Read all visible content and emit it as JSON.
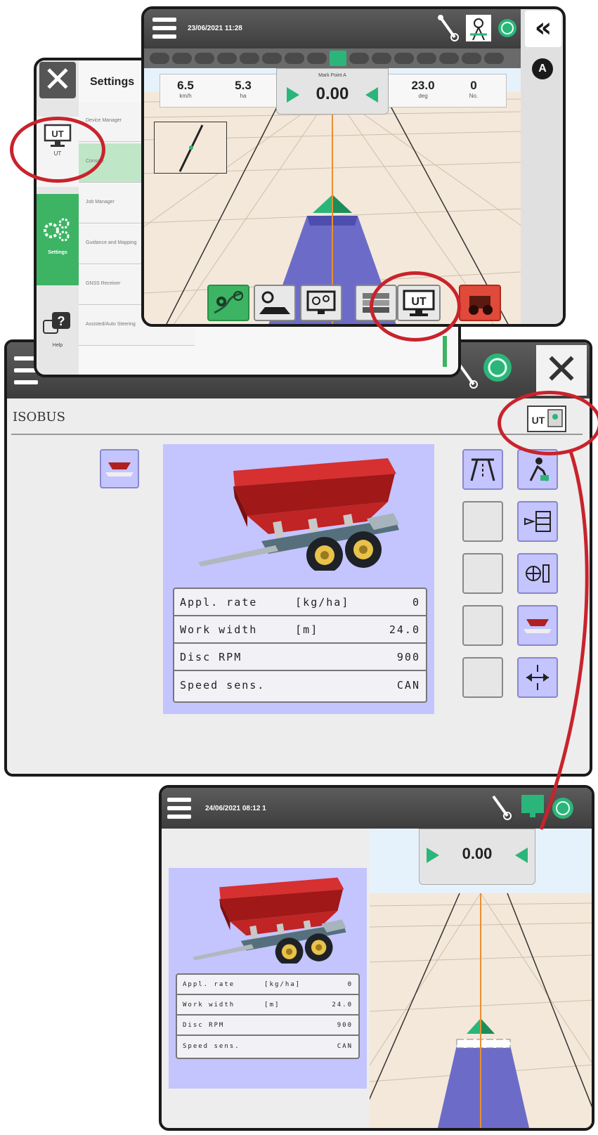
{
  "colors": {
    "accent_green": "#2bb57a",
    "callout_red": "#c8232c",
    "implement_blue": "#c4c4ff",
    "settings_green": "#3cb464"
  },
  "top_screen": {
    "datetime": "23/06/2021 11:28",
    "info_bar": [
      {
        "value": "6.5",
        "unit": "km/h"
      },
      {
        "value": "5.3",
        "unit": "ha"
      },
      {
        "value": "23.0",
        "unit": "deg"
      },
      {
        "value": "0",
        "unit": "No."
      }
    ],
    "guidance": {
      "label": "Mark Point A",
      "value": "0.00"
    },
    "badge": "A",
    "ut_label": "UT",
    "active_progress_segment": 8,
    "progress_segments": 16
  },
  "settings_screen": {
    "title": "Settings",
    "sidebar": [
      {
        "label": "UT"
      },
      {
        "label": "Settings"
      },
      {
        "label": "Help"
      }
    ],
    "items": [
      "Device Manager",
      "Console",
      "Job Manager",
      "Guidance and Mapping",
      "GNSS Receiver",
      "Assisted/Auto Steering"
    ]
  },
  "isobus_screen": {
    "title": "ISOBUS",
    "ut_label": "UT",
    "table": [
      {
        "name": "Appl. rate",
        "unit": "[kg/ha]",
        "value": "0"
      },
      {
        "name": "Work width",
        "unit": "[m]",
        "value": "24.0"
      },
      {
        "name": "Disc RPM",
        "unit": "",
        "value": "900"
      },
      {
        "name": "Speed sens.",
        "unit": "",
        "value": "CAN"
      }
    ]
  },
  "bottom_screen": {
    "datetime": "24/06/2021 08:12 1",
    "guidance_value": "0.00",
    "table": [
      {
        "name": "Appl. rate",
        "unit": "[kg/ha]",
        "value": "0"
      },
      {
        "name": "Work width",
        "unit": "[m]",
        "value": "24.0"
      },
      {
        "name": "Disc RPM",
        "unit": "",
        "value": "900"
      },
      {
        "name": "Speed sens.",
        "unit": "",
        "value": "CAN"
      }
    ]
  }
}
